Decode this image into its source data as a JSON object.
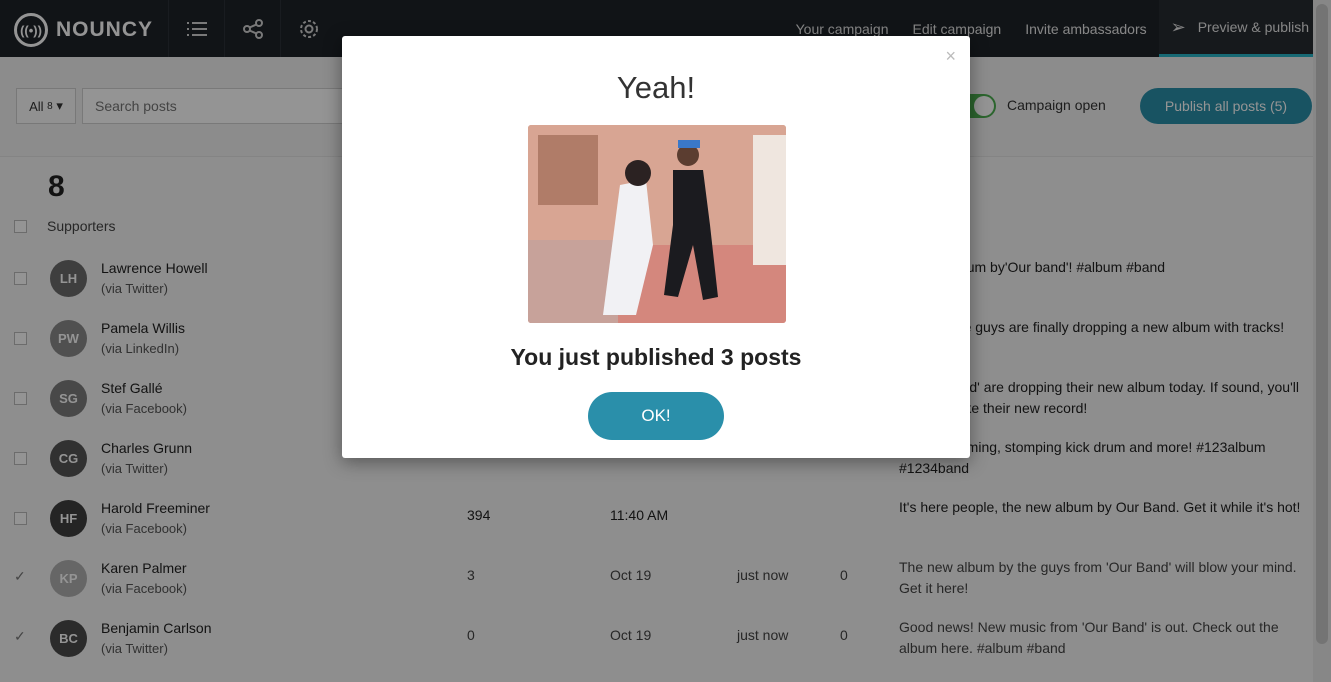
{
  "app": {
    "brand": "NOUNCY",
    "logo_icon": "wifi-circle-icon"
  },
  "nav": {
    "tabs": [
      {
        "label": "Your campaign"
      },
      {
        "label": "Edit campaign"
      },
      {
        "label": "Invite ambassadors"
      },
      {
        "label": "Preview & publish",
        "icon": "paper-plane-icon",
        "active": true
      }
    ]
  },
  "toolbar": {
    "filter_label": "All",
    "filter_count": "8",
    "search_placeholder": "Search posts",
    "campaign_open_label": "Campaign open",
    "campaign_open": true,
    "publish_label": "Publish all posts (5)"
  },
  "list": {
    "count": "8",
    "supporters_label": "Supporters",
    "rows": [
      {
        "name": "Lawrence Howell",
        "via": "(via Twitter)",
        "reach": "",
        "date": "",
        "status": "",
        "zero": "",
        "message": "he new album by'Our band'! #album #band",
        "checked": false
      },
      {
        "name": "Pamela Willis",
        "via": "(via LinkedIn)",
        "reach": "",
        "date": "",
        "status": "",
        "zero": "",
        "message": "y that these guys are finally dropping a new album with tracks!",
        "checked": false
      },
      {
        "name": "Stef Gallé",
        "via": "(via Facebook)",
        "reach": "",
        "date": "",
        "status": "",
        "zero": "",
        "message": "at 'Our Band' are dropping their new album today. If sound, you'll definitely like their new record!",
        "checked": false
      },
      {
        "name": "Charles Grunn",
        "via": "(via Twitter)",
        "reach": "",
        "date": "",
        "status": "",
        "zero": "",
        "message": "ustic strumming, stomping kick drum and more! #123album #1234band",
        "checked": false
      },
      {
        "name": "Harold Freeminer",
        "via": "(via Facebook)",
        "reach": "394",
        "date": "11:40 AM",
        "status": "",
        "zero": "",
        "message": "It's here people, the new album by Our Band. Get it while it's hot!",
        "checked": false
      },
      {
        "name": "Karen Palmer",
        "via": "(via Facebook)",
        "reach": "3",
        "date": "Oct 19",
        "status": "just now",
        "zero": "0",
        "message": "The new album by the guys from 'Our Band' will blow your mind. Get it here!",
        "checked": true
      },
      {
        "name": "Benjamin Carlson",
        "via": "(via Twitter)",
        "reach": "0",
        "date": "Oct 19",
        "status": "just now",
        "zero": "0",
        "message": "Good news! New music from 'Our Band' is out. Check out the album here. #album #band",
        "checked": true
      }
    ]
  },
  "modal": {
    "close": "×",
    "title": "Yeah!",
    "message": "You just published 3 posts",
    "ok_label": "OK!"
  }
}
